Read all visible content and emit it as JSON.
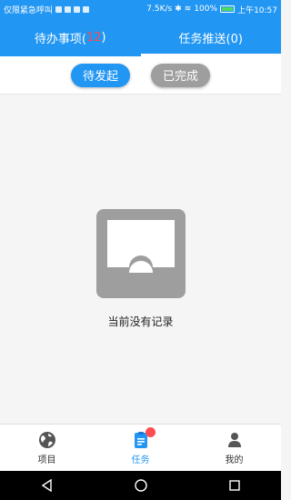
{
  "statusbar": {
    "carrier": "仅限紧急呼叫",
    "speed": "7.5K/s",
    "battery": "100%",
    "time": "上午10:57"
  },
  "tabs": [
    {
      "label": "待办事项(",
      "count": "12",
      "suffix": ")"
    },
    {
      "label": "任务推送(0)"
    }
  ],
  "filters": {
    "pending": "待发起",
    "done": "已完成"
  },
  "empty": {
    "text": "当前没有记录"
  },
  "bottomnav": {
    "items": [
      {
        "label": "项目",
        "icon": "globe-icon"
      },
      {
        "label": "任务",
        "icon": "clipboard-icon"
      },
      {
        "label": "我的",
        "icon": "person-icon"
      }
    ]
  },
  "colors": {
    "primary": "#2196f3",
    "badge": "#ff4d4f",
    "chip_inactive": "#9e9e9e",
    "empty_icon": "#9e9e9e"
  }
}
